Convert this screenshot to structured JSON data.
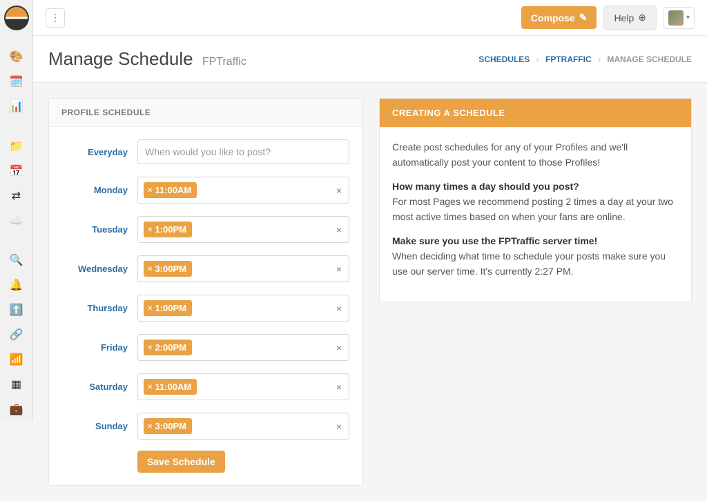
{
  "topbar": {
    "compose_label": "Compose",
    "help_label": "Help"
  },
  "header": {
    "title": "Manage Schedule",
    "subtitle": "FPTraffic"
  },
  "breadcrumb": {
    "schedules": "SCHEDULES",
    "profile": "FPTRAFFIC",
    "current": "MANAGE SCHEDULE"
  },
  "schedule_panel": {
    "title": "PROFILE SCHEDULE",
    "placeholder": "When would you like to post?",
    "save_label": "Save Schedule",
    "rows": {
      "everyday": {
        "label": "Everyday"
      },
      "monday": {
        "label": "Monday",
        "time": "11:00AM"
      },
      "tuesday": {
        "label": "Tuesday",
        "time": "1:00PM"
      },
      "wednesday": {
        "label": "Wednesday",
        "time": "3:00PM"
      },
      "thursday": {
        "label": "Thursday",
        "time": "1:00PM"
      },
      "friday": {
        "label": "Friday",
        "time": "2:00PM"
      },
      "saturday": {
        "label": "Saturday",
        "time": "11:00AM"
      },
      "sunday": {
        "label": "Sunday",
        "time": "3:00PM"
      }
    }
  },
  "help_panel": {
    "title": "CREATING A SCHEDULE",
    "intro": "Create post schedules for any of your Profiles and we'll automatically post your content to those Profiles!",
    "q1_strong": "How many times a day should you post?",
    "q1_body": "For most Pages we recommend posting 2 times a day at your two most active times based on when your fans are online.",
    "q2_strong": "Make sure you use the FPTraffic server time!",
    "q2_body": "When deciding what time to schedule your posts make sure you use our server time. It's currently 2:27 PM."
  }
}
